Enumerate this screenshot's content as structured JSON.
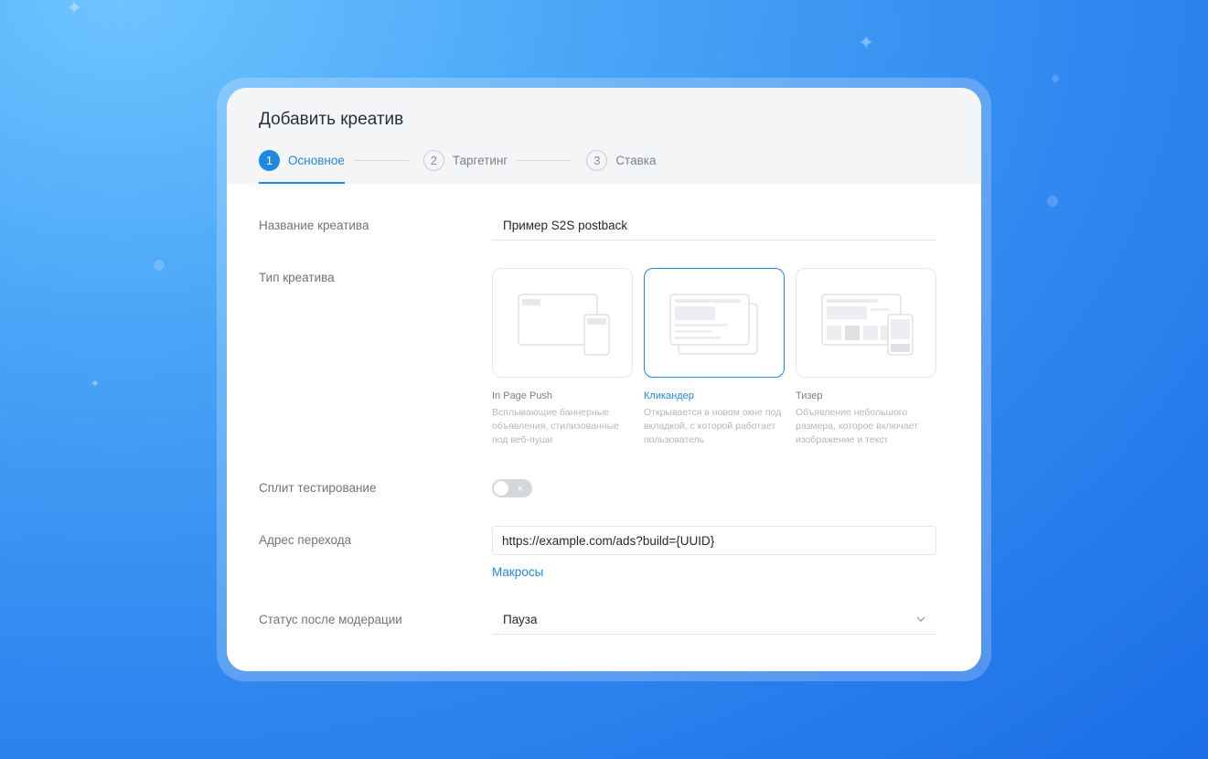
{
  "form": {
    "title": "Добавить креатив",
    "steps": [
      {
        "num": "1",
        "label": "Основное",
        "active": true
      },
      {
        "num": "2",
        "label": "Таргетинг",
        "active": false
      },
      {
        "num": "3",
        "label": "Ставка",
        "active": false
      }
    ],
    "name_label": "Название креатива",
    "name_value": "Пример S2S postback",
    "type_label": "Тип креатива",
    "types": [
      {
        "title": "In Page Push",
        "desc": "Всплывающие баннерные объявления, стилизованные под веб-пуши",
        "selected": false
      },
      {
        "title": "Кликандер",
        "desc": "Открывается в новом окне под вкладкой, с которой работает пользователь",
        "selected": true
      },
      {
        "title": "Тизер",
        "desc": "Объявление небольшого размера, которое включает изображение и текст",
        "selected": false
      }
    ],
    "split_label": "Сплит тестирование",
    "split_toggle_icon": "×",
    "split_enabled": false,
    "url_label": "Адрес перехода",
    "url_value": "https://example.com/ads?build={UUID}",
    "macros_link": "Макросы",
    "status_label": "Статус после модерации",
    "status_value": "Пауза"
  },
  "colors": {
    "accent": "#1e88e5",
    "background": "#2f86ef"
  }
}
